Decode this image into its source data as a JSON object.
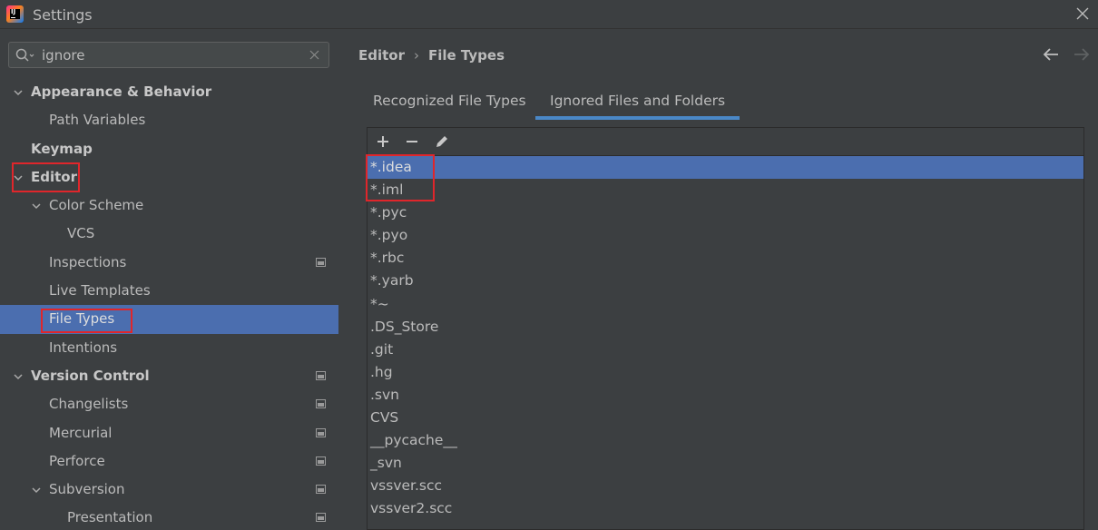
{
  "window": {
    "title": "Settings"
  },
  "search": {
    "value": "ignore"
  },
  "sidebar": {
    "items": [
      {
        "label": "Appearance & Behavior",
        "level": 0,
        "expanded": true,
        "bold": true
      },
      {
        "label": "Path Variables",
        "level": 1
      },
      {
        "label": "Keymap",
        "level": 0,
        "bold": true
      },
      {
        "label": "Editor",
        "level": 0,
        "expanded": true,
        "bold": true,
        "highlighted": true
      },
      {
        "label": "Color Scheme",
        "level": 1,
        "expanded": true
      },
      {
        "label": "VCS",
        "level": 2
      },
      {
        "label": "Inspections",
        "level": 1,
        "project_icon": true
      },
      {
        "label": "Live Templates",
        "level": 1
      },
      {
        "label": "File Types",
        "level": 1,
        "selected": true,
        "highlighted": true
      },
      {
        "label": "Intentions",
        "level": 1
      },
      {
        "label": "Version Control",
        "level": 0,
        "expanded": true,
        "bold": true,
        "project_icon": true
      },
      {
        "label": "Changelists",
        "level": 1,
        "project_icon": true
      },
      {
        "label": "Mercurial",
        "level": 1,
        "project_icon": true
      },
      {
        "label": "Perforce",
        "level": 1,
        "project_icon": true
      },
      {
        "label": "Subversion",
        "level": 1,
        "expanded": true,
        "project_icon": true
      },
      {
        "label": "Presentation",
        "level": 2,
        "project_icon": true
      }
    ]
  },
  "breadcrumb": {
    "parent": "Editor",
    "separator": "›",
    "current": "File Types"
  },
  "tabs": [
    {
      "label": "Recognized File Types",
      "active": false
    },
    {
      "label": "Ignored Files and Folders",
      "active": true
    }
  ],
  "toolbar": {
    "buttons": [
      "add-icon",
      "remove-icon",
      "edit-icon"
    ]
  },
  "ignored_files": [
    "*.idea",
    "*.iml",
    "*.pyc",
    "*.pyo",
    "*.rbc",
    "*.yarb",
    "*~",
    ".DS_Store",
    ".git",
    ".hg",
    ".svn",
    "CVS",
    "__pycache__",
    "_svn",
    "vssver.scc",
    "vssver2.scc"
  ],
  "colors": {
    "background": "#3c3f41",
    "selection": "#4b6eaf",
    "tab_underline": "#4a88c7",
    "annotation": "#e0262b"
  }
}
